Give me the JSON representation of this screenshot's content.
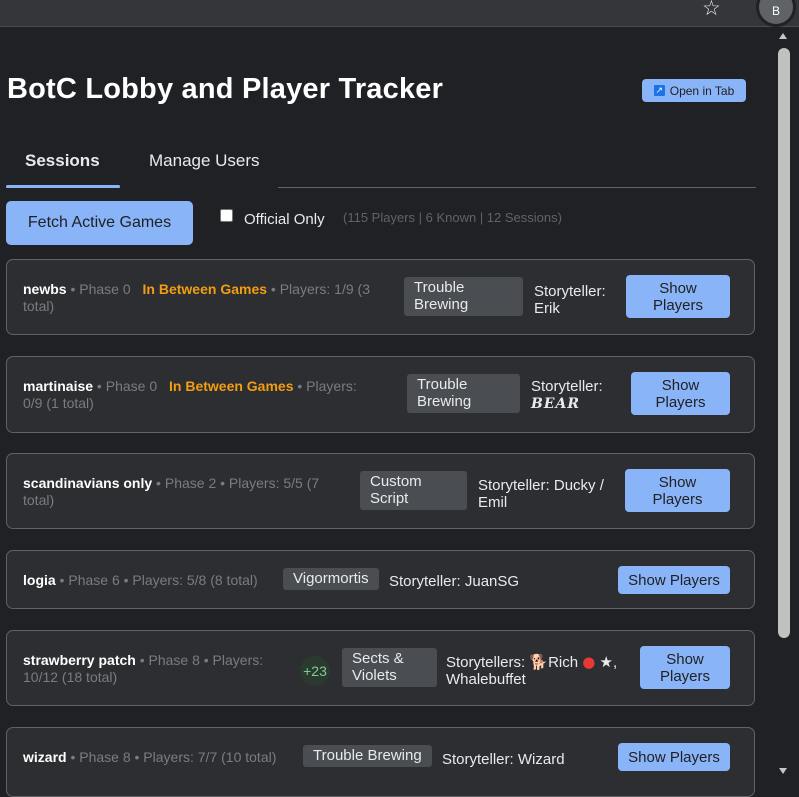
{
  "browser": {
    "profile_initial": "B",
    "star_icon": "star-icon"
  },
  "app": {
    "title": "BotC Lobby and Player Tracker",
    "open_in_tab": "Open in Tab"
  },
  "tabs": [
    {
      "label": "Sessions",
      "active": true
    },
    {
      "label": "Manage Users",
      "active": false
    }
  ],
  "controls": {
    "fetch_label": "Fetch Active Games",
    "official_only_label": "Official Only",
    "official_only_checked": false,
    "stats": "(115 Players | 6 Known | 12 Sessions)"
  },
  "sessions": [
    {
      "name": "newbs",
      "meta_line1": " • Phase 0 ",
      "status": "In Between Games",
      "meta_after_status": " • Players: 1/9 (3",
      "meta_line2": "total)",
      "script": [
        "Trouble",
        "Brewing"
      ],
      "storyteller_label": "Storyteller:",
      "storyteller": "Erik",
      "button": [
        "Show",
        "Players"
      ]
    },
    {
      "name": "martinaise",
      "meta_line1": " • Phase 0 ",
      "status": "In Between Games",
      "meta_after_status": " • Players:",
      "meta_line2": "0/9 (1 total)",
      "script": [
        "Trouble",
        "Brewing"
      ],
      "storyteller_label": "Storyteller:",
      "storyteller": "BEAR",
      "button": [
        "Show",
        "Players"
      ]
    },
    {
      "name": "scandinavians only",
      "meta_line1": " • Phase 2 • Players: 5/5 (7",
      "meta_line2": "total)",
      "script": [
        "Custom",
        "Script"
      ],
      "storyteller_label": "Storyteller:",
      "storyteller_line1": "Ducky /",
      "storyteller_line2": "Emil",
      "button": [
        "Show",
        "Players"
      ]
    },
    {
      "name": "logia",
      "meta_line1": " • Phase 6 • Players: 5/8 (8 total)",
      "script": [
        "Vigormortis"
      ],
      "storyteller_label": "Storyteller:",
      "storyteller": "JuanSG",
      "button": [
        "Show Players"
      ]
    },
    {
      "name": "strawberry patch",
      "meta_line1": " • Phase 8 • Players:",
      "meta_line2": "10/12 (18 total)",
      "extra_badge": "+23",
      "script": [
        "Sects &",
        "Violets"
      ],
      "storyteller_label": "Storytellers:",
      "storyteller_line1": "Rich",
      "storyteller_line1_suffix": "★,",
      "storyteller_line2": "Whalebuffet",
      "button": [
        "Show",
        "Players"
      ]
    },
    {
      "name": "wizard",
      "meta_line1": " • Phase 8 • Players: 7/7 (10 total)",
      "script": [
        "Trouble Brewing"
      ],
      "storyteller_label": "Storyteller:",
      "storyteller": "Wizard",
      "button": [
        "Show Players"
      ]
    }
  ]
}
